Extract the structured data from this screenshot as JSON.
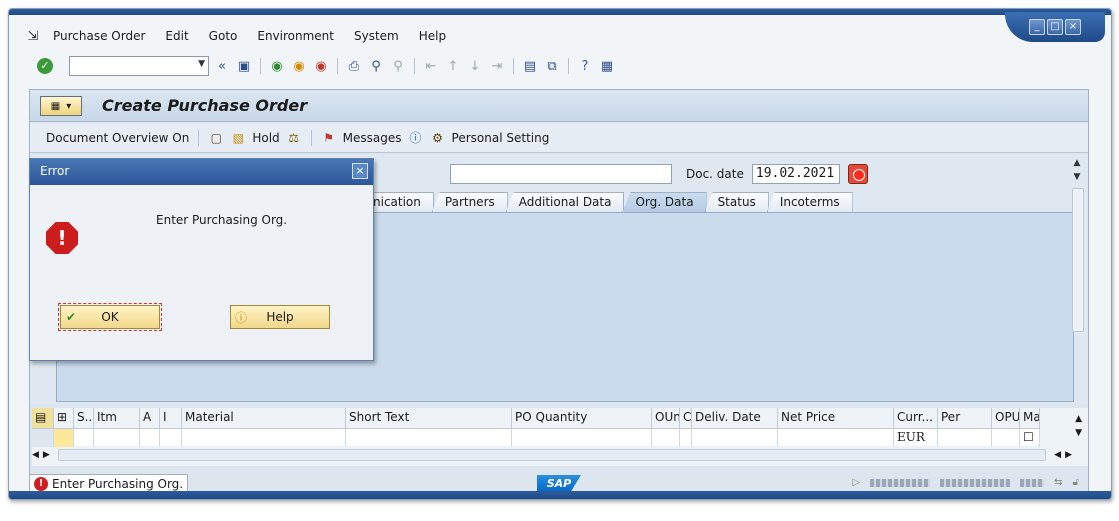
{
  "menu": {
    "items": [
      "Purchase Order",
      "Edit",
      "Goto",
      "Environment",
      "System",
      "Help"
    ]
  },
  "toolbar": {
    "command_value": "",
    "back_label": "«"
  },
  "screen": {
    "title": "Create Purchase Order"
  },
  "app_toolbar": {
    "document_overview": "Document Overview On",
    "hold": "Hold",
    "messages": "Messages",
    "personal_setting": "Personal Setting"
  },
  "header_fields": {
    "supplier_value": "",
    "doc_date_label": "Doc. date",
    "doc_date_value": "19.02.2021"
  },
  "tabs": [
    "nication",
    "Partners",
    "Additional Data",
    "Org. Data",
    "Status",
    "Incoterms"
  ],
  "active_tab": "Org. Data",
  "item_grid": {
    "columns": [
      "S..",
      "Itm",
      "A",
      "I",
      "Material",
      "Short Text",
      "PO Quantity",
      "OUn",
      "C",
      "Deliv. Date",
      "Net Price",
      "Curr...",
      "Per",
      "OPU",
      "Ma"
    ],
    "row_currency": "EUR"
  },
  "dialog": {
    "title": "Error",
    "message": "Enter Purchasing Org.",
    "ok_label": "OK",
    "help_label": "Help"
  },
  "status": {
    "message": "Enter Purchasing Org.",
    "logo": "SAP"
  },
  "colors": {
    "title_bar": "#2b5699",
    "error": "#cc1c1c",
    "button": "#f2d78a"
  }
}
